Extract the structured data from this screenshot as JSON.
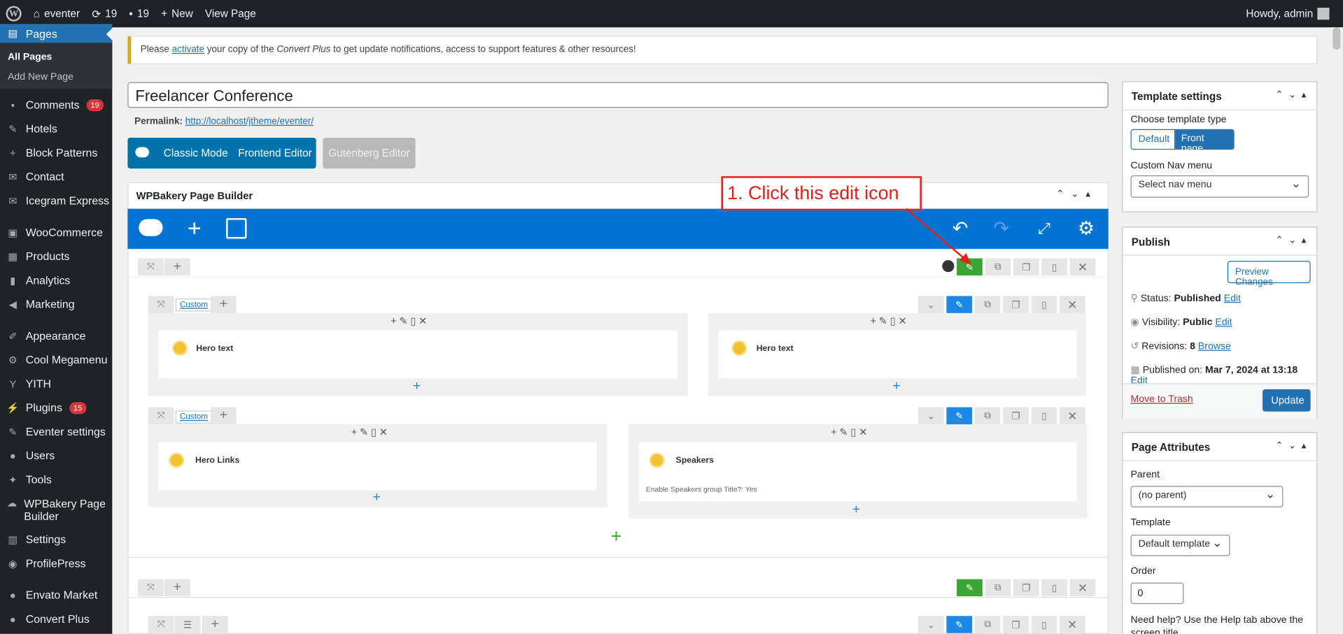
{
  "adminbar": {
    "site": "eventer",
    "updates": "19",
    "comments": "19",
    "new": "New",
    "view_page": "View Page",
    "howdy": "Howdy, admin"
  },
  "sidebar": {
    "pages": "Pages",
    "all_pages": "All Pages",
    "add_new_page": "Add New Page",
    "items": [
      {
        "label": "Comments",
        "badge": "19",
        "icon": "comment-icon"
      },
      {
        "label": "Hotels",
        "icon": "pin-icon"
      },
      {
        "label": "Block Patterns",
        "icon": "plus-icon"
      },
      {
        "label": "Contact",
        "icon": "mail-icon"
      },
      {
        "label": "Icegram Express",
        "icon": "mail-icon"
      },
      {
        "label": "WooCommerce",
        "icon": "woo-icon"
      },
      {
        "label": "Products",
        "icon": "archive-icon"
      },
      {
        "label": "Analytics",
        "icon": "chart-icon"
      },
      {
        "label": "Marketing",
        "icon": "megaphone-icon"
      },
      {
        "label": "Appearance",
        "icon": "brush-icon"
      },
      {
        "label": "Cool Megamenu",
        "icon": "gear-icon"
      },
      {
        "label": "YITH",
        "icon": "yith-icon"
      },
      {
        "label": "Plugins",
        "badge": "15",
        "icon": "plug-icon"
      },
      {
        "label": "Eventer settings",
        "icon": "pencil-icon"
      },
      {
        "label": "Users",
        "icon": "user-icon"
      },
      {
        "label": "Tools",
        "icon": "wrench-icon"
      },
      {
        "label": "WPBakery Page Builder",
        "icon": "cloud-icon"
      },
      {
        "label": "Settings",
        "icon": "settings-icon"
      },
      {
        "label": "ProfilePress",
        "icon": "profile-icon"
      },
      {
        "label": "Envato Market",
        "icon": "leaf-icon"
      },
      {
        "label": "Convert Plus",
        "icon": "convert-icon"
      }
    ]
  },
  "notice": {
    "before": "Please ",
    "link": "activate",
    "middle": " your copy of the ",
    "product": "Convert Plus",
    "after": " to get update notifications, access to support features & other resources!"
  },
  "post": {
    "title": "Freelancer Conference",
    "permalink_label": "Permalink:",
    "permalink_url": "http://localhost/jtheme/eventer/"
  },
  "modes": {
    "classic": "Classic Mode",
    "frontend": "Frontend Editor",
    "gutenberg": "Gutenberg Editor"
  },
  "builder": {
    "title": "WPBakery Page Builder",
    "custom_label": "Custom",
    "elements": {
      "hero_text_1": "Hero text",
      "hero_text_2": "Hero text",
      "hero_links": "Hero Links",
      "speakers": "Speakers",
      "speakers_param": "Enable Speakers group Title?: Yes"
    }
  },
  "annotation": {
    "text": "1. Click this edit icon",
    "color": "#e0201b"
  },
  "template_settings": {
    "title": "Template settings",
    "choose_label": "Choose template type",
    "default_btn": "Default",
    "front_btn": "Front page",
    "nav_label": "Custom Nav menu",
    "nav_select": "Select nav menu"
  },
  "publish": {
    "title": "Publish",
    "preview": "Preview Changes",
    "status_label": "Status:",
    "status_value": "Published",
    "visibility_label": "Visibility:",
    "visibility_value": "Public",
    "revisions_label": "Revisions:",
    "revisions_value": "8",
    "browse": "Browse",
    "published_label": "Published on:",
    "published_value": "Mar 7, 2024 at 13:18",
    "edit": "Edit",
    "trash": "Move to Trash",
    "update": "Update"
  },
  "page_attributes": {
    "title": "Page Attributes",
    "parent_label": "Parent",
    "parent_value": "(no parent)",
    "template_label": "Template",
    "template_value": "Default template",
    "order_label": "Order",
    "order_value": "0",
    "help": "Need help? Use the Help tab above the screen title."
  },
  "colors": {
    "wpb_blue": "#0473d2",
    "edit_green": "#3ba534",
    "wp_blue": "#2271b1",
    "admin_dark": "#1d2327"
  }
}
